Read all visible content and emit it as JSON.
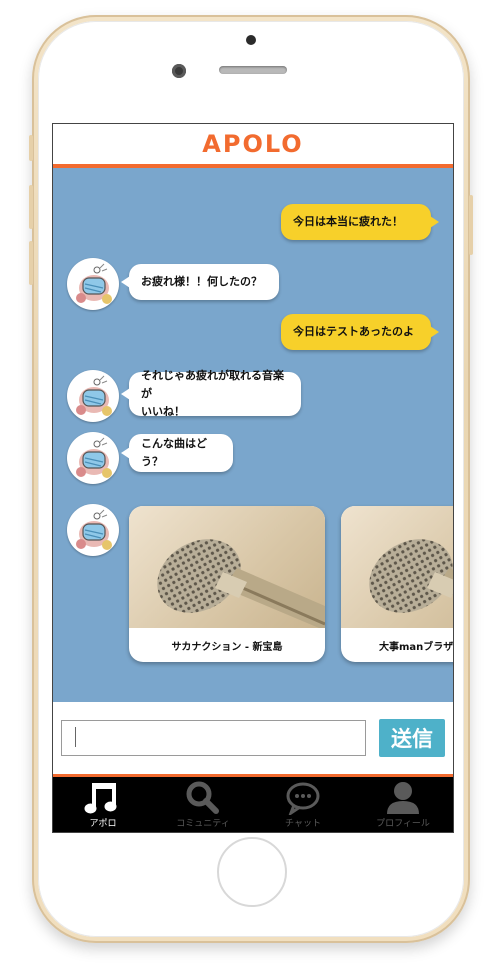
{
  "app": {
    "title": "APOLO"
  },
  "messages": [
    {
      "side": "sent",
      "text": "今日は本当に疲れた！"
    },
    {
      "side": "received",
      "text": "お疲れ様！！何したの？"
    },
    {
      "side": "sent",
      "text": "今日はテストあったのよ"
    },
    {
      "side": "received",
      "lines": [
        "それじゃあ疲れが取れる音楽が",
        "いいね！"
      ]
    },
    {
      "side": "received",
      "text": "こんな曲はどう？"
    }
  ],
  "songs": [
    {
      "label": "サカナクション - 新宝島"
    },
    {
      "label": "大事manブラザ"
    }
  ],
  "composer": {
    "value": "",
    "placeholder": "",
    "send_label": "送信"
  },
  "tabs": [
    {
      "icon": "music-note-icon",
      "label": "アポロ",
      "active": true
    },
    {
      "icon": "search-icon",
      "label": "コミュニティ",
      "active": false
    },
    {
      "icon": "chat-bubble-icon",
      "label": "チャット",
      "active": false
    },
    {
      "icon": "person-icon",
      "label": "プロフィール",
      "active": false
    }
  ],
  "colors": {
    "accent": "#f26b2f",
    "chat_background": "#7aa6cc",
    "sent_bubble": "#f7d02a",
    "received_bubble": "#ffffff",
    "send_button": "#4eb1c9",
    "tabbar": "#000000"
  }
}
